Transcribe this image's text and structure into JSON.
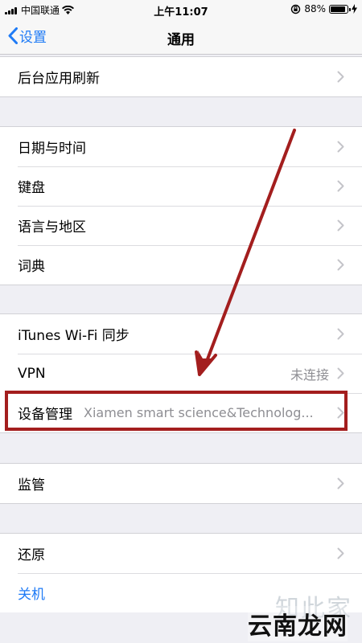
{
  "status_bar": {
    "carrier": "中国联通",
    "time": "上午11:07",
    "battery": "88%",
    "battery_level": 0.88
  },
  "nav": {
    "back_label": "设置",
    "title": "通用"
  },
  "groups": {
    "g1": {
      "background_refresh": "后台应用刷新"
    },
    "g2": {
      "date_time": "日期与时间",
      "keyboard": "键盘",
      "language_region": "语言与地区",
      "dictionary": "词典"
    },
    "g3": {
      "itunes_sync": "iTunes Wi-Fi 同步",
      "vpn": "VPN",
      "vpn_status": "未连接",
      "device_management": "设备管理",
      "device_management_value": "Xiamen smart science&Technolog..."
    },
    "g4": {
      "supervision": "监管"
    },
    "g5": {
      "reset": "还原",
      "shutdown": "关机"
    }
  },
  "watermark": {
    "top": "知此家",
    "bottom": "云南龙网"
  },
  "colors": {
    "accent_blue": "#1f7bf6",
    "annotation_red": "#a31e1e",
    "background": "#efeff4"
  }
}
